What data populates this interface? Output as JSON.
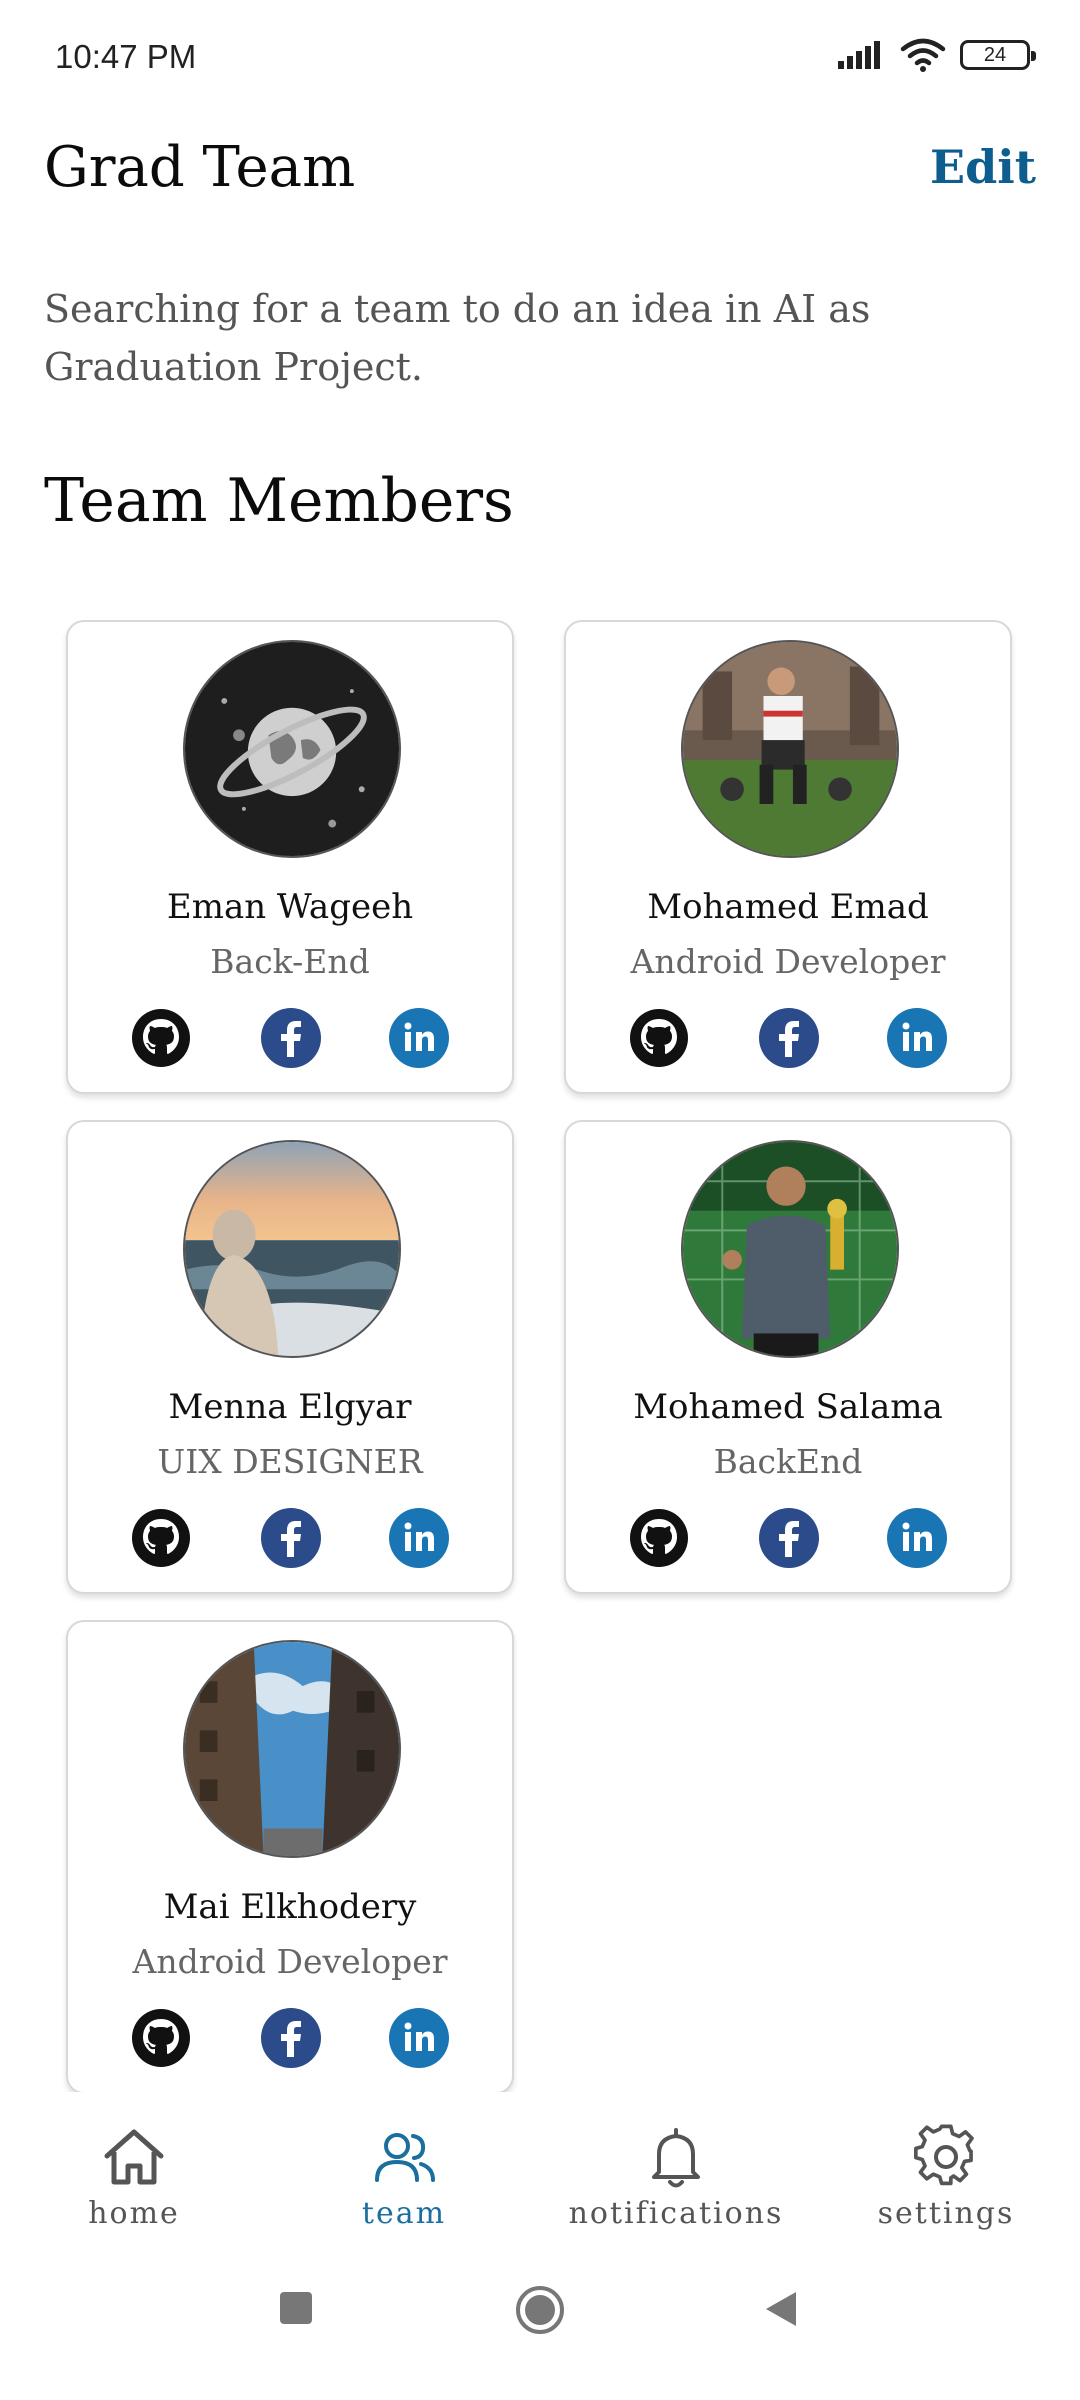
{
  "status_bar": {
    "time": "10:47 PM",
    "battery": "24"
  },
  "header": {
    "title": "Grad Team",
    "edit_label": "Edit"
  },
  "description": "Searching for a team to do an idea in AI as Graduation Project.",
  "section_title": "Team Members",
  "members": [
    {
      "name": "Eman Wageeh",
      "role": "Back-End",
      "avatar": "space-planet-avatar"
    },
    {
      "name": "Mohamed Emad",
      "role": "Android Developer",
      "avatar": "gym-photo-avatar"
    },
    {
      "name": "Menna Elgyar",
      "role": "UIX DESIGNER",
      "avatar": "sea-sunset-avatar"
    },
    {
      "name": "Mohamed Salama",
      "role": "BackEnd",
      "avatar": "trophy-photo-avatar"
    },
    {
      "name": "Mai Elkhodery",
      "role": "Android Developer",
      "avatar": "street-sky-avatar"
    }
  ],
  "social_icons": [
    "github-icon",
    "facebook-icon",
    "linkedin-icon"
  ],
  "bottom_nav": {
    "items": [
      {
        "label": "home",
        "icon": "home-icon"
      },
      {
        "label": "team",
        "icon": "team-icon",
        "active": true
      },
      {
        "label": "notifications",
        "icon": "bell-icon"
      },
      {
        "label": "settings",
        "icon": "gear-icon"
      }
    ]
  },
  "colors": {
    "accent": "#0d5d8f",
    "facebook": "#2b4b8a",
    "linkedin": "#1a75b5",
    "active_nav": "#1a6f9e"
  }
}
